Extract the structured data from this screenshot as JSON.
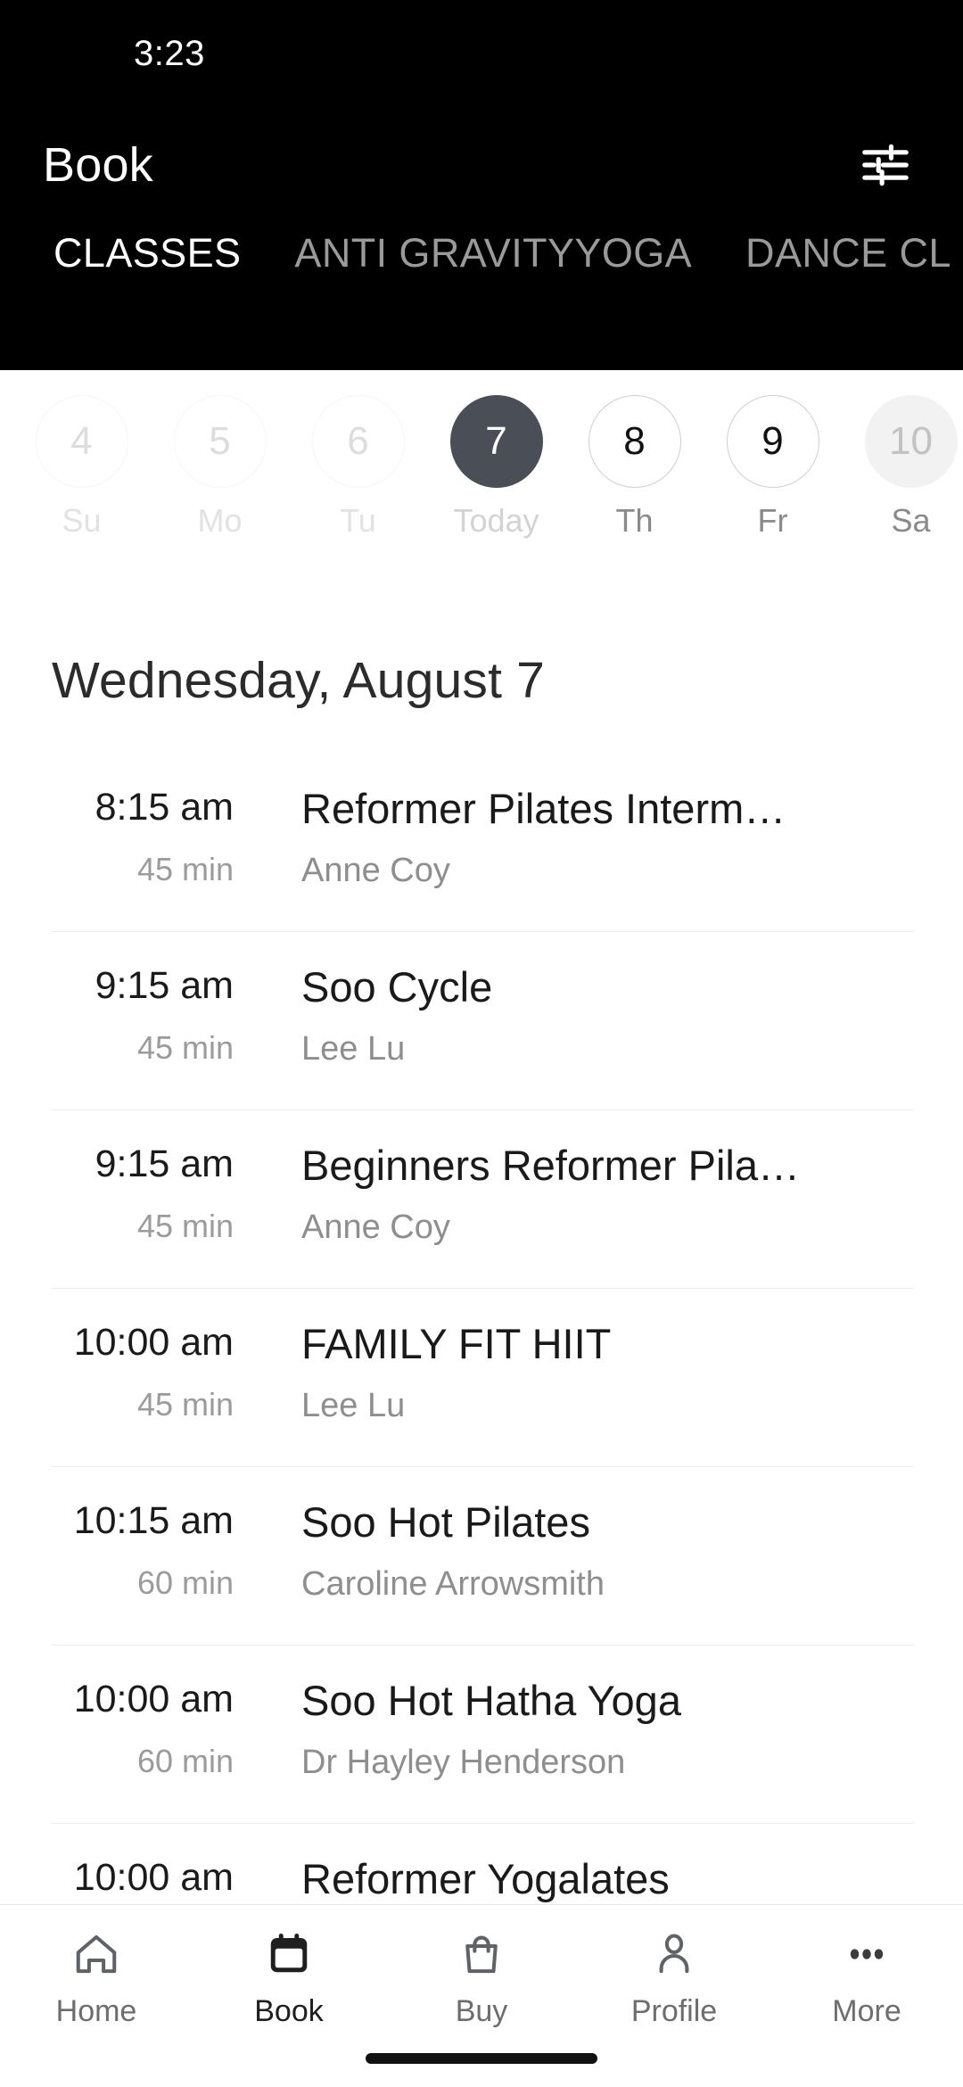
{
  "status_bar": {
    "time": "3:23"
  },
  "header": {
    "title": "Book",
    "filter_icon": "tune-filter-icon",
    "tabs": [
      {
        "label": "CLASSES",
        "active": true
      },
      {
        "label": "ANTI GRAVITYYOGA",
        "active": false
      },
      {
        "label": "DANCE CL",
        "active": false
      }
    ]
  },
  "date_strip": [
    {
      "day": "4",
      "weekday": "Su",
      "state": "past"
    },
    {
      "day": "5",
      "weekday": "Mo",
      "state": "past"
    },
    {
      "day": "6",
      "weekday": "Tu",
      "state": "past"
    },
    {
      "day": "7",
      "weekday": "Today",
      "state": "today"
    },
    {
      "day": "8",
      "weekday": "Th",
      "state": "future"
    },
    {
      "day": "9",
      "weekday": "Fr",
      "state": "future"
    },
    {
      "day": "10",
      "weekday": "Sa",
      "state": "muted"
    }
  ],
  "day_heading": "Wednesday, August 7",
  "classes": [
    {
      "time": "8:15 am",
      "duration": "45 min",
      "name": "Reformer Pilates Interme…",
      "instructor": "Anne Coy"
    },
    {
      "time": "9:15 am",
      "duration": "45 min",
      "name": "Soo Cycle",
      "instructor": "Lee Lu"
    },
    {
      "time": "9:15 am",
      "duration": "45 min",
      "name": "Beginners Reformer Pilat…",
      "instructor": "Anne Coy"
    },
    {
      "time": "10:00 am",
      "duration": "45 min",
      "name": "FAMILY FIT HIIT",
      "instructor": "Lee Lu"
    },
    {
      "time": "10:15 am",
      "duration": "60 min",
      "name": "Soo Hot Pilates",
      "instructor": "Caroline Arrowsmith"
    },
    {
      "time": "10:00 am",
      "duration": "60 min",
      "name": "Soo Hot Hatha Yoga",
      "instructor": "Dr Hayley Henderson"
    },
    {
      "time": "10:00 am",
      "duration": "",
      "name": "Reformer Yogalates",
      "instructor": ""
    }
  ],
  "bottom_nav": [
    {
      "label": "Home",
      "icon": "home-icon",
      "active": false
    },
    {
      "label": "Book",
      "icon": "calendar-icon",
      "active": true
    },
    {
      "label": "Buy",
      "icon": "bag-icon",
      "active": false
    },
    {
      "label": "Profile",
      "icon": "person-icon",
      "active": false
    },
    {
      "label": "More",
      "icon": "dots-icon",
      "active": false
    }
  ],
  "colors": {
    "header_bg": "#000000",
    "selected_date": "#4a4e57",
    "text_primary": "#1a1a1a",
    "text_secondary": "#8e8e8e",
    "divider": "#eeeeee"
  }
}
